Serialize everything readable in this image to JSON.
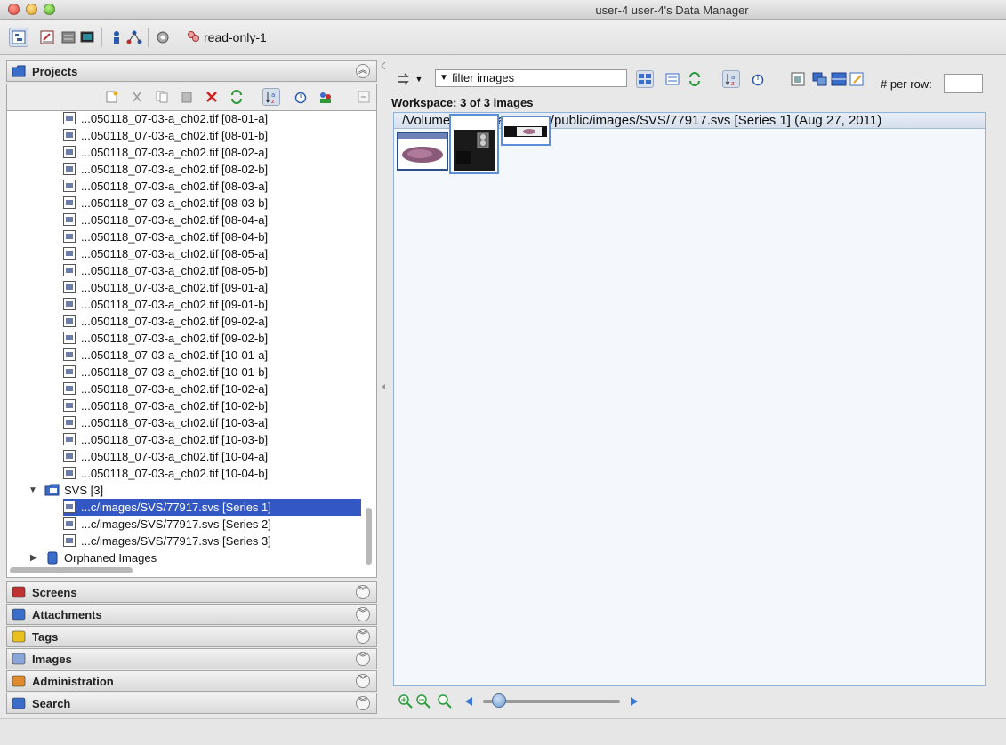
{
  "window": {
    "title": "user-4 user-4's Data Manager"
  },
  "toolbar": {
    "group_label": "read-only-1"
  },
  "projects_panel": {
    "title": "Projects",
    "tree_rows": [
      "...050118_07-03-a_ch02.tif [08-01-a]",
      "...050118_07-03-a_ch02.tif [08-01-b]",
      "...050118_07-03-a_ch02.tif [08-02-a]",
      "...050118_07-03-a_ch02.tif [08-02-b]",
      "...050118_07-03-a_ch02.tif [08-03-a]",
      "...050118_07-03-a_ch02.tif [08-03-b]",
      "...050118_07-03-a_ch02.tif [08-04-a]",
      "...050118_07-03-a_ch02.tif [08-04-b]",
      "...050118_07-03-a_ch02.tif [08-05-a]",
      "...050118_07-03-a_ch02.tif [08-05-b]",
      "...050118_07-03-a_ch02.tif [09-01-a]",
      "...050118_07-03-a_ch02.tif [09-01-b]",
      "...050118_07-03-a_ch02.tif [09-02-a]",
      "...050118_07-03-a_ch02.tif [09-02-b]",
      "...050118_07-03-a_ch02.tif [10-01-a]",
      "...050118_07-03-a_ch02.tif [10-01-b]",
      "...050118_07-03-a_ch02.tif [10-02-a]",
      "...050118_07-03-a_ch02.tif [10-02-b]",
      "...050118_07-03-a_ch02.tif [10-03-a]",
      "...050118_07-03-a_ch02.tif [10-03-b]",
      "...050118_07-03-a_ch02.tif [10-04-a]",
      "...050118_07-03-a_ch02.tif [10-04-b]"
    ],
    "dataset_label": "SVS [3]",
    "dataset_images": [
      "...c/images/SVS/77917.svs [Series 1]",
      "...c/images/SVS/77917.svs [Series 2]",
      "...c/images/SVS/77917.svs [Series 3]"
    ],
    "orphaned_label": "Orphaned Images"
  },
  "panels": [
    "Screens",
    "Attachments",
    "Tags",
    "Images",
    "Administration",
    "Search"
  ],
  "workspace": {
    "filter_text": "filter  images",
    "per_row_label": "# per row:",
    "per_row_value": "",
    "count_label": "Workspace: 3 of 3 images",
    "path_title": "/Volumes/ome/data_repo/public/images/SVS/77917.svs [Series 1] (Aug 27, 2011)"
  },
  "colors": {
    "selection": "#3358c4",
    "thumb_border": "#5b8fd6"
  }
}
